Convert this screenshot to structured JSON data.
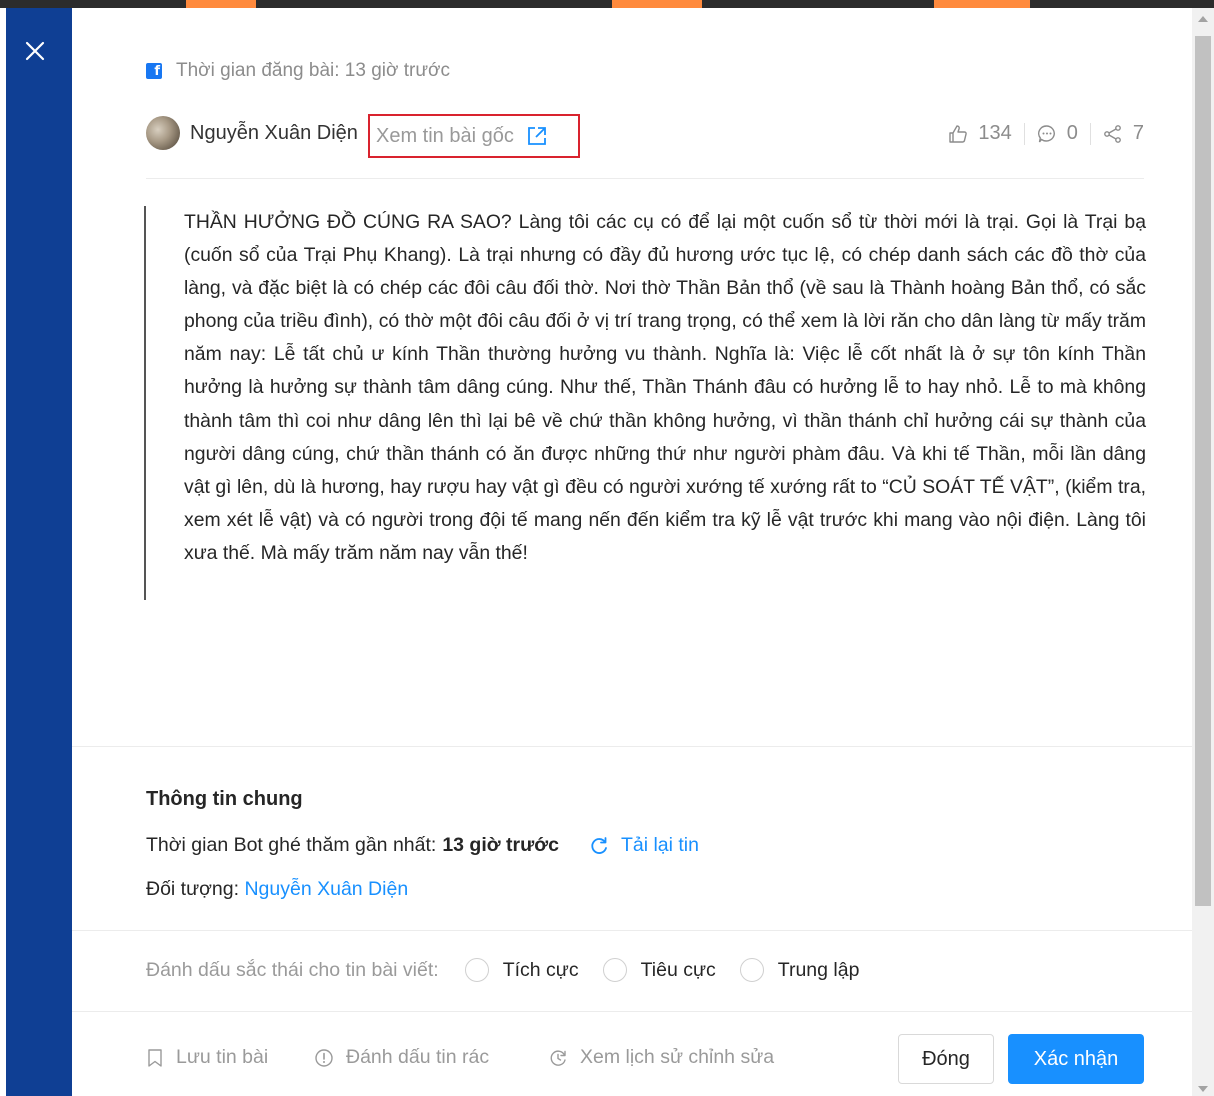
{
  "header": {
    "post_time_label": "Thời gian đăng bài: 13 giờ trước",
    "source_icon": "facebook-icon"
  },
  "author": {
    "name": "Nguyễn Xuân Diện",
    "view_original": "Xem tin bài gốc",
    "view_original_icon": "external-link-icon"
  },
  "stats": {
    "likes": "134",
    "comments": "0",
    "shares": "7"
  },
  "post": {
    "content": "THẦN HƯỞNG ĐỒ CÚNG RA SAO? Làng tôi các cụ có để lại một cuốn sổ từ thời mới là trại. Gọi là Trại bạ (cuốn sổ của Trại Phụ Khang). Là trại nhưng có đầy đủ hương ước tục lệ, có chép danh sách các đồ thờ của làng, và đặc biệt là có chép các đôi câu đối thờ. Nơi thờ Thần Bản thổ (về sau là Thành hoàng Bản thổ, có sắc phong của triều đình), có thờ một đôi câu đối ở vị trí trang trọng, có thể xem là lời răn cho dân làng từ mấy trăm năm nay: Lễ tất chủ ư kính Thần thường hưởng vu thành. Nghĩa là: Việc lễ cốt nhất là ở sự tôn kính Thần hưởng là hưởng sự thành tâm dâng cúng. Như thế, Thần Thánh đâu có hưởng lễ to hay nhỏ. Lễ to mà không thành tâm thì coi như dâng lên thì lại bê về chứ thần không hưởng, vì thần thánh chỉ hưởng cái sự thành của người dâng cúng, chứ thần thánh có ăn được những thứ như người phàm đâu. Và khi tế Thần, mỗi lần dâng vật gì lên, dù là hương, hay rượu hay vật gì đều có người xướng tế xướng rất to “CỦ SOÁT TẾ VẬT”, (kiểm tra, xem xét lễ vật) và có người trong đội tế mang nến đến kiểm tra kỹ lễ vật trước khi mang vào nội điện. Làng tôi xưa thế. Mà mấy trăm năm nay vẫn thế!"
  },
  "info": {
    "title": "Thông tin chung",
    "bot_visit_label": "Thời gian Bot ghé thăm gần nhất:",
    "bot_visit_value": "13 giờ trước",
    "reload_label": "Tải lại tin",
    "target_label": "Đối tượng: ",
    "target_value": "Nguyễn Xuân Diện"
  },
  "sentiment": {
    "label": "Đánh dấu sắc thái cho tin bài viết:",
    "options": [
      "Tích cực",
      "Tiêu cực",
      "Trung lập"
    ]
  },
  "footer": {
    "save": "Lưu tin bài",
    "mark_spam": "Đánh dấu tin rác",
    "history": "Xem lịch sử chỉnh sửa",
    "close": "Đóng",
    "confirm": "Xác nhận"
  },
  "colors": {
    "sidebar": "#0f3f94",
    "accent": "#1890ff",
    "highlight_border": "#d9232e"
  }
}
